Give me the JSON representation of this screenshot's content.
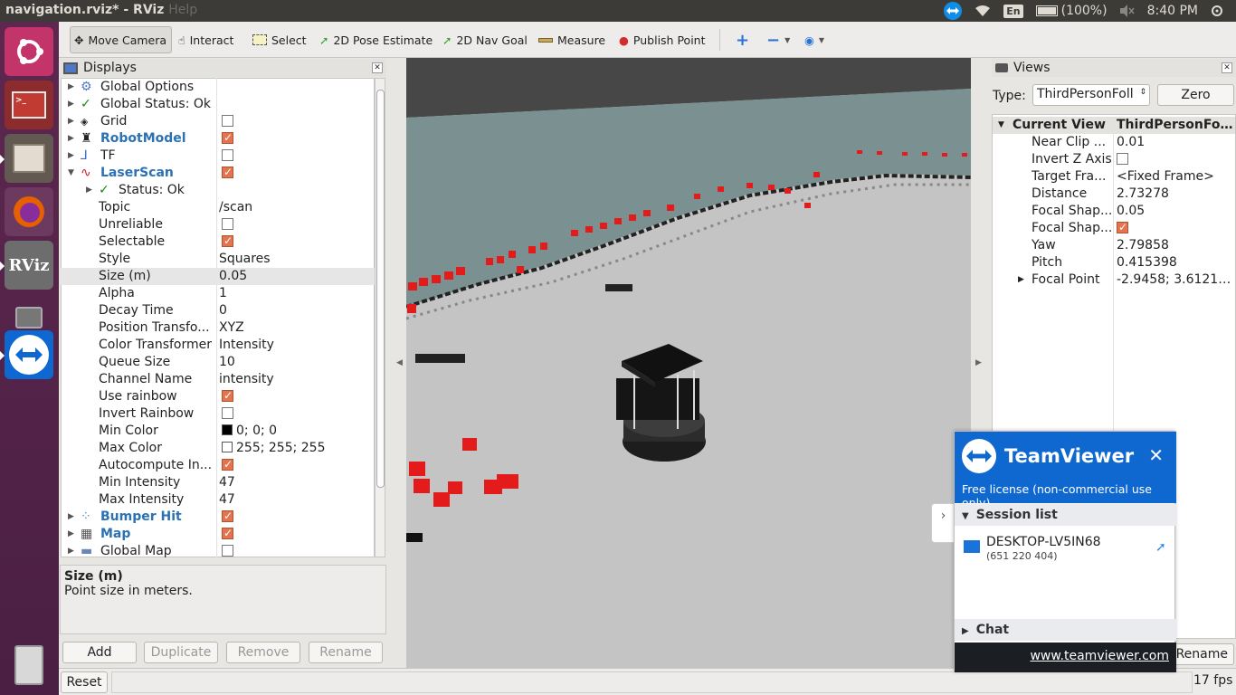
{
  "window": {
    "title": "navigation.rviz* - RViz",
    "menu_hint": "Help"
  },
  "tray": {
    "lang": "En",
    "battery": "(100%)",
    "time": "8:40 PM"
  },
  "launcher": {
    "rviz_label": "RViz"
  },
  "toolbar": {
    "move_camera": "Move Camera",
    "interact": "Interact",
    "select": "Select",
    "pose_estimate": "2D Pose Estimate",
    "nav_goal": "2D Nav Goal",
    "measure": "Measure",
    "publish_point": "Publish Point"
  },
  "displays": {
    "title": "Displays",
    "rows": [
      {
        "name": "Global Options",
        "value": ""
      },
      {
        "name": "Global Status: Ok",
        "value": ""
      },
      {
        "name": "Grid",
        "value": ""
      },
      {
        "name": "RobotModel",
        "value": ""
      },
      {
        "name": "TF",
        "value": ""
      },
      {
        "name": "LaserScan",
        "value": ""
      },
      {
        "name": "Status: Ok",
        "value": ""
      },
      {
        "name": "Topic",
        "value": "/scan"
      },
      {
        "name": "Unreliable",
        "value": ""
      },
      {
        "name": "Selectable",
        "value": ""
      },
      {
        "name": "Style",
        "value": "Squares"
      },
      {
        "name": "Size (m)",
        "value": "0.05"
      },
      {
        "name": "Alpha",
        "value": "1"
      },
      {
        "name": "Decay Time",
        "value": "0"
      },
      {
        "name": "Position Transfo...",
        "value": "XYZ"
      },
      {
        "name": "Color Transformer",
        "value": "Intensity"
      },
      {
        "name": "Queue Size",
        "value": "10"
      },
      {
        "name": "Channel Name",
        "value": "intensity"
      },
      {
        "name": "Use rainbow",
        "value": ""
      },
      {
        "name": "Invert Rainbow",
        "value": ""
      },
      {
        "name": "Min Color",
        "value": "0; 0; 0"
      },
      {
        "name": "Max Color",
        "value": "255; 255; 255"
      },
      {
        "name": "Autocompute In...",
        "value": ""
      },
      {
        "name": "Min Intensity",
        "value": "47"
      },
      {
        "name": "Max Intensity",
        "value": "47"
      },
      {
        "name": "Bumper Hit",
        "value": ""
      },
      {
        "name": "Map",
        "value": ""
      },
      {
        "name": "Global Map",
        "value": ""
      }
    ],
    "desc_title": "Size (m)",
    "desc_text": "Point size in meters.",
    "buttons": {
      "add": "Add",
      "duplicate": "Duplicate",
      "remove": "Remove",
      "rename": "Rename"
    }
  },
  "views": {
    "title": "Views",
    "type_label": "Type:",
    "type_value": "ThirdPersonFoll",
    "zero": "Zero",
    "header_key": "Current View",
    "header_value": "ThirdPersonFol...",
    "rows": [
      {
        "k": "Near Clip ...",
        "v": "0.01"
      },
      {
        "k": "Invert Z Axis",
        "v": ""
      },
      {
        "k": "Target Fra...",
        "v": "<Fixed Frame>"
      },
      {
        "k": "Distance",
        "v": "2.73278"
      },
      {
        "k": "Focal Shap...",
        "v": "0.05"
      },
      {
        "k": "Focal Shap...",
        "v": ""
      },
      {
        "k": "Yaw",
        "v": "2.79858"
      },
      {
        "k": "Pitch",
        "v": "0.415398"
      },
      {
        "k": "Focal Point",
        "v": "-2.9458; 3.6121; ..."
      }
    ],
    "rename": "Rename"
  },
  "status": {
    "reset": "Reset",
    "fps": "17 fps"
  },
  "teamviewer": {
    "brand": "TeamViewer",
    "license": "Free license (non-commercial use only)",
    "session_list": "Session list",
    "device_name": "DESKTOP-LV5IN68",
    "device_id": "(651 220 404)",
    "chat": "Chat",
    "link": "www.teamviewer.com"
  }
}
